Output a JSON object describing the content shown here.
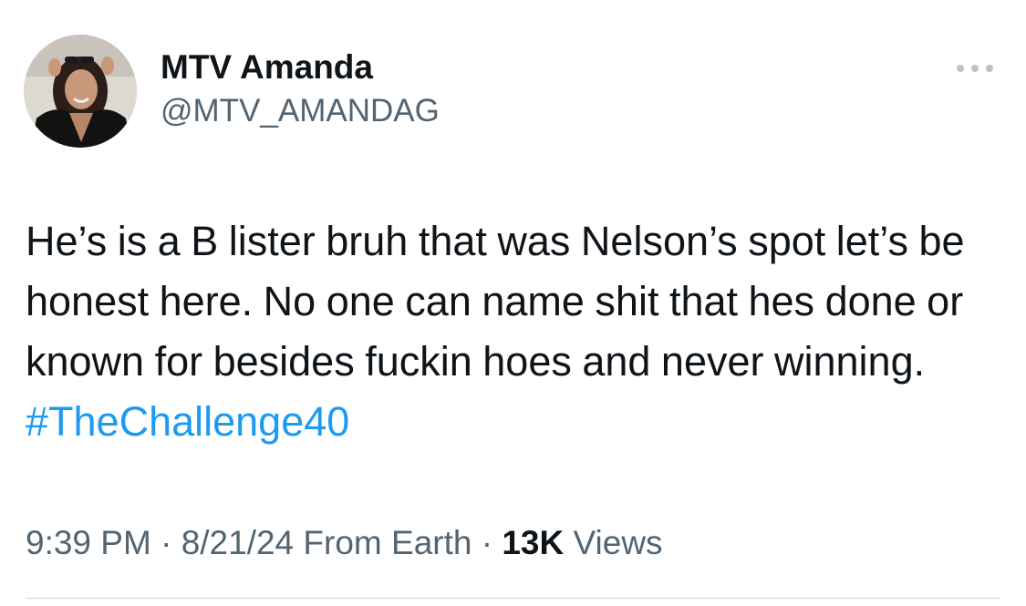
{
  "author": {
    "display_name": "MTV Amanda",
    "handle": "@MTV_AMANDAG",
    "avatar_icon": "profile-photo"
  },
  "more_icon": "ellipsis-icon",
  "tweet": {
    "text": "He’s is a B lister bruh that was Nelson’s spot let’s be honest here. No one can name shit that hes done or known for besides fuckin hoes and never winning. ",
    "hashtag": "#TheChallenge40"
  },
  "meta": {
    "time": "9:39 PM",
    "separator": " · ",
    "date": "8/21/24",
    "source": " From Earth",
    "separator2": " · ",
    "views_count": "13K",
    "views_label": " Views"
  },
  "colors": {
    "text": "#0f1419",
    "secondary": "#536471",
    "link": "#1d9bf0",
    "divider": "#cfd9de"
  }
}
